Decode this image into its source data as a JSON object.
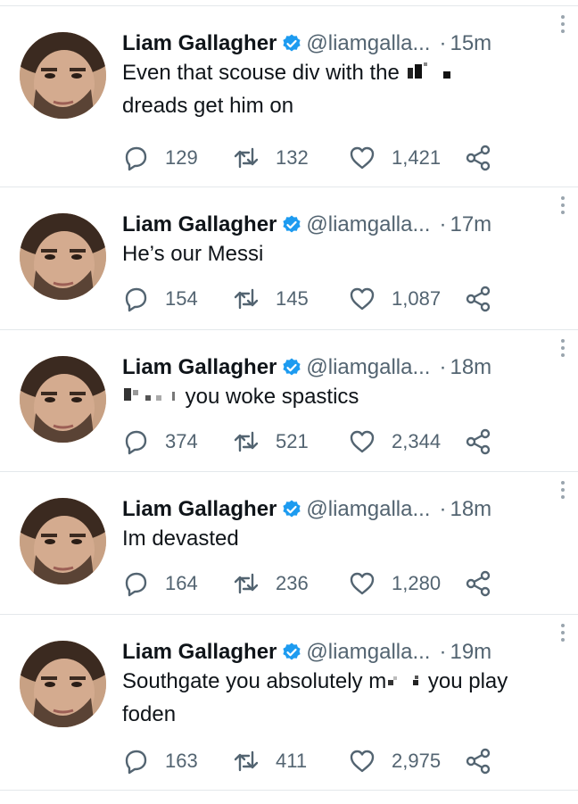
{
  "colors": {
    "verified": "#1d9bf0",
    "secondary_text": "#536471",
    "divider": "#e4e8eb"
  },
  "icons": [
    "verified-badge-icon",
    "more-options-icon",
    "reply-icon",
    "retweet-icon",
    "like-icon",
    "share-icon"
  ],
  "tweets": [
    {
      "name": "Liam Gallagher",
      "handle": "@liamgalla...",
      "separator": "·",
      "time": "15m",
      "text_parts": [
        "Even that scouse div with the ",
        "",
        "dreads get him on"
      ],
      "replies": "129",
      "retweets": "132",
      "likes": "1,421"
    },
    {
      "name": "Liam Gallagher",
      "handle": "@liamgalla...",
      "separator": "·",
      "time": "17m",
      "text_parts": [
        "He’s our Messi"
      ],
      "replies": "154",
      "retweets": "145",
      "likes": "1,087"
    },
    {
      "name": "Liam Gallagher",
      "handle": "@liamgalla...",
      "separator": "·",
      "time": "18m",
      "text_parts": [
        "",
        " you woke spastics"
      ],
      "replies": "374",
      "retweets": "521",
      "likes": "2,344"
    },
    {
      "name": "Liam Gallagher",
      "handle": "@liamgalla...",
      "separator": "·",
      "time": "18m",
      "text_parts": [
        "Im devasted"
      ],
      "replies": "164",
      "retweets": "236",
      "likes": "1,280"
    },
    {
      "name": "Liam Gallagher",
      "handle": "@liamgalla...",
      "separator": "·",
      "time": "19m",
      "text_parts": [
        "Southgate you absolutely m",
        " you play",
        "foden"
      ],
      "replies": "163",
      "retweets": "411",
      "likes": "2,975"
    }
  ]
}
